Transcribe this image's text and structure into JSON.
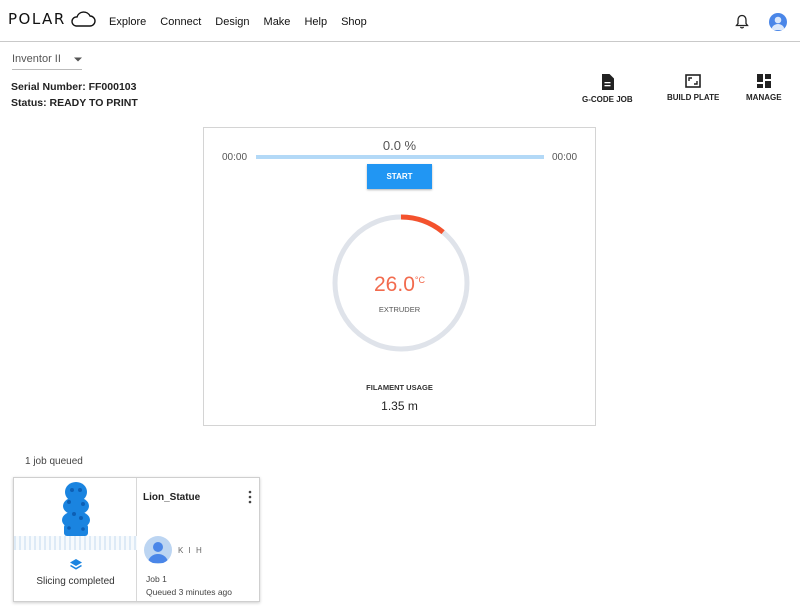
{
  "brand": {
    "name": "POLAR"
  },
  "nav": [
    "Explore",
    "Connect",
    "Design",
    "Make",
    "Help",
    "Shop"
  ],
  "icons": {
    "notifications": "bell-icon",
    "account": "avatar-icon",
    "cloud": "cloud-icon"
  },
  "printer": {
    "name": "Inventor II",
    "serial": "Serial Number: FF000103",
    "status": "Status: READY TO PRINT"
  },
  "actions": {
    "gcode": "G-CODE JOB",
    "build_plate": "BUILD PLATE",
    "manage": "MANAGE"
  },
  "progress": {
    "percent_text": "0.0 %",
    "percent": 0,
    "elapsed": "00:00",
    "remaining": "00:00",
    "start_label": "START"
  },
  "extruder": {
    "temperature": "26.0",
    "unit": "°C",
    "label": "EXTRUDER",
    "gauge_fraction": 0.11
  },
  "filament": {
    "label": "FILAMENT USAGE",
    "value": "1.35 m"
  },
  "queue": {
    "count_text": "1 job queued",
    "jobs": [
      {
        "name": "Lion_Statue",
        "slice_status": "Slicing completed",
        "user": "K I H",
        "job_number": "Job 1",
        "queued_time": "Queued 3 minutes ago"
      }
    ]
  },
  "colors": {
    "accent": "#2196f3",
    "progress_track": "#b3d9f7",
    "temperature": "#f26b4e",
    "gauge_arc": "#f4522d",
    "gauge_track": "#dfe3ea"
  }
}
